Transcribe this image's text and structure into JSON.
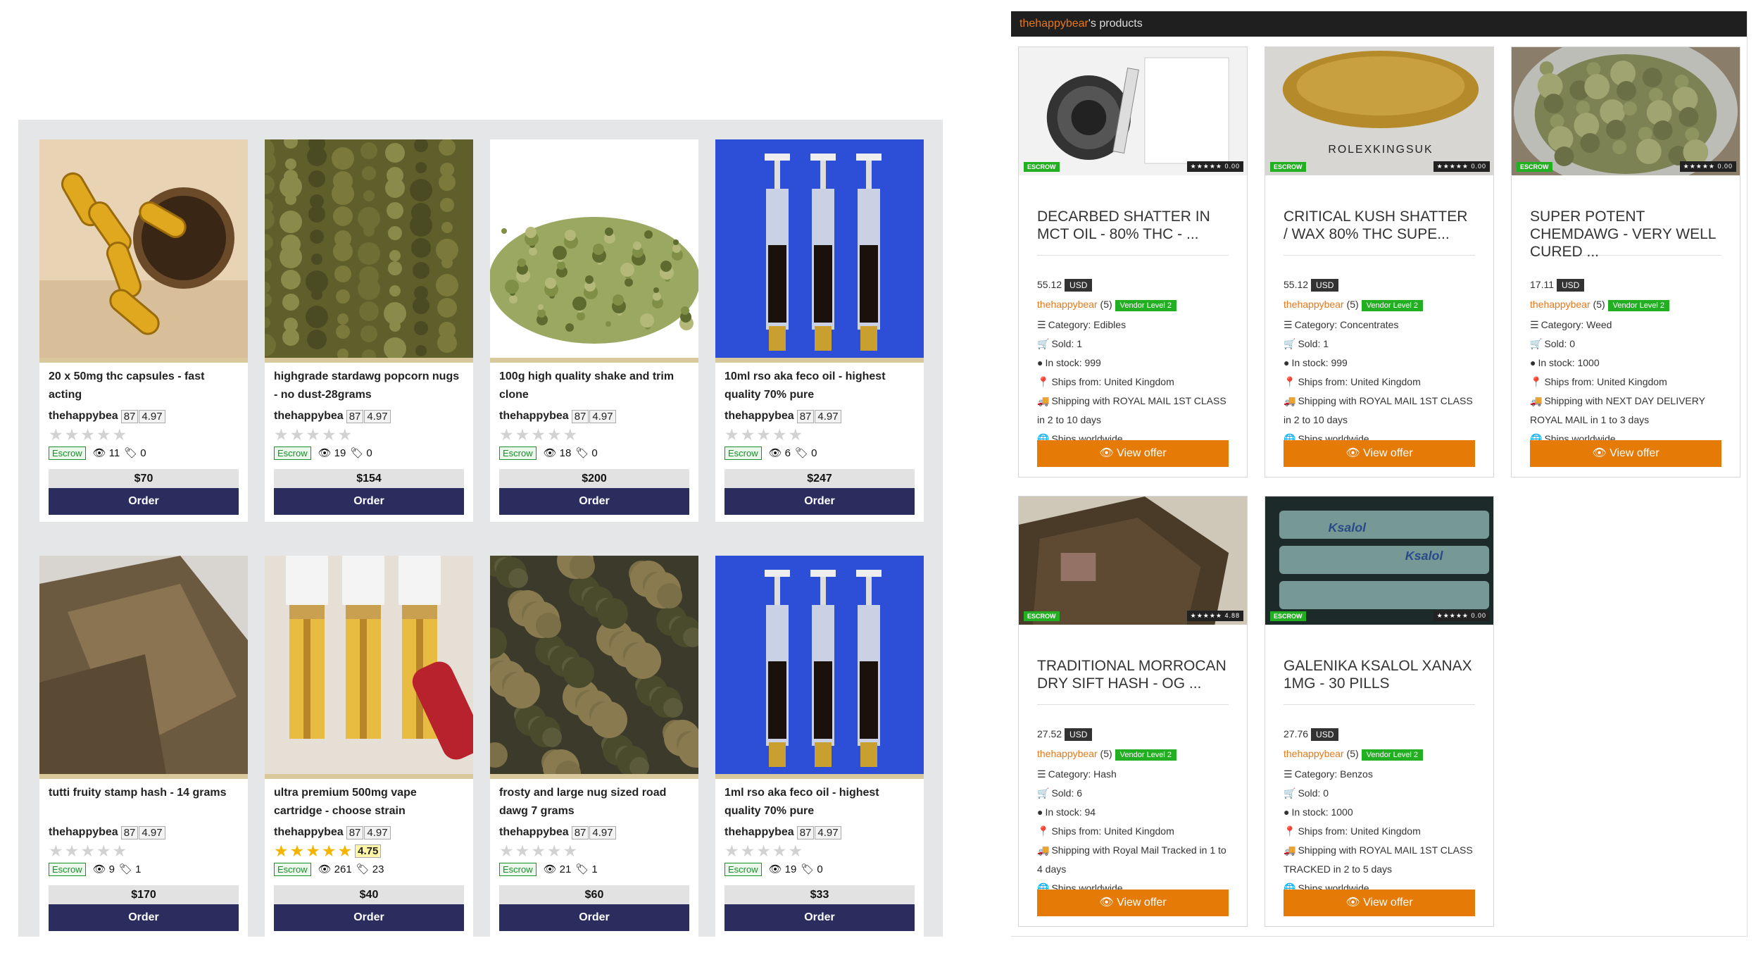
{
  "left": {
    "products": [
      {
        "title": "20 x 50mg thc capsules - fast acting",
        "vendor": "thehappybea",
        "vendor_count": "87",
        "vendor_rating": "4.97",
        "product_rating": "",
        "escrow": "Escrow",
        "views": "11",
        "sales": "0",
        "price": "$70",
        "order": "Order",
        "image": "capsules"
      },
      {
        "title": "highgrade stardawg popcorn nugs - no dust-28grams",
        "vendor": "thehappybea",
        "vendor_count": "87",
        "vendor_rating": "4.97",
        "product_rating": "",
        "escrow": "Escrow",
        "views": "19",
        "sales": "0",
        "price": "$154",
        "order": "Order",
        "image": "popcorn-nugs"
      },
      {
        "title": "100g high quality shake and trim clone",
        "vendor": "thehappybea",
        "vendor_count": "87",
        "vendor_rating": "4.97",
        "product_rating": "",
        "escrow": "Escrow",
        "views": "18",
        "sales": "0",
        "price": "$200",
        "order": "Order",
        "image": "shake"
      },
      {
        "title": "10ml rso aka feco oil - highest quality 70% pure",
        "vendor": "thehappybea",
        "vendor_count": "87",
        "vendor_rating": "4.97",
        "product_rating": "",
        "escrow": "Escrow",
        "views": "6",
        "sales": "0",
        "price": "$247",
        "order": "Order",
        "image": "syringes"
      },
      {
        "title": "tutti fruity stamp hash - 14 grams",
        "vendor": "thehappybea",
        "vendor_count": "87",
        "vendor_rating": "4.97",
        "product_rating": "",
        "escrow": "Escrow",
        "views": "9",
        "sales": "1",
        "price": "$170",
        "order": "Order",
        "image": "hash"
      },
      {
        "title": "ultra premium 500mg vape cartridge - choose strain",
        "vendor": "thehappybea",
        "vendor_count": "87",
        "vendor_rating": "4.97",
        "product_rating": "4.75",
        "escrow": "Escrow",
        "views": "261",
        "sales": "23",
        "price": "$40",
        "order": "Order",
        "image": "vape"
      },
      {
        "title": "frosty and large nug sized road dawg 7 grams",
        "vendor": "thehappybea",
        "vendor_count": "87",
        "vendor_rating": "4.97",
        "product_rating": "",
        "escrow": "Escrow",
        "views": "21",
        "sales": "1",
        "price": "$60",
        "order": "Order",
        "image": "nug"
      },
      {
        "title": "1ml rso aka feco oil - highest quality 70% pure",
        "vendor": "thehappybea",
        "vendor_count": "87",
        "vendor_rating": "4.97",
        "product_rating": "",
        "escrow": "Escrow",
        "views": "19",
        "sales": "0",
        "price": "$33",
        "order": "Order",
        "image": "syringes"
      }
    ]
  },
  "right": {
    "header_vendor": "thehappybear",
    "header_suffix": "'s products",
    "products": [
      {
        "title": "DECARBED SHATTER IN MCT OIL - 80% THC - ...",
        "price": "55.12",
        "currency": "USD",
        "vendor": "thehappybear",
        "vendor_count": "(5)",
        "level": "Vendor Level 2",
        "category": "Category: Edibles",
        "sold": "Sold: 1",
        "stock": "In stock: 999",
        "ships_from": "Ships from: United Kingdom",
        "shipping": "Shipping with ROYAL MAIL 1ST CLASS in 2 to 10 days",
        "worldwide": "Ships worldwide",
        "button": "View offer",
        "escrow": "ESCROW",
        "stars": "★★★★★ 0.00",
        "image": "jar-syringe"
      },
      {
        "title": "CRITICAL KUSH SHATTER / WAX 80% THC SUPE...",
        "price": "55.12",
        "currency": "USD",
        "vendor": "thehappybear",
        "vendor_count": "(5)",
        "level": "Vendor Level 2",
        "category": "Category: Concentrates",
        "sold": "Sold: 1",
        "stock": "In stock: 999",
        "ships_from": "Ships from: United Kingdom",
        "shipping": "Shipping with ROYAL MAIL 1ST CLASS in 2 to 10 days",
        "worldwide": "Ships worldwide",
        "button": "View offer",
        "escrow": "ESCROW",
        "stars": "★★★★★ 0.00",
        "image": "shatter",
        "image_text": "ROLEXKINGSUK"
      },
      {
        "title": "SUPER POTENT CHEMDAWG - VERY WELL CURED ...",
        "price": "17.11",
        "currency": "USD",
        "vendor": "thehappybear",
        "vendor_count": "(5)",
        "level": "Vendor Level 2",
        "category": "Category: Weed",
        "sold": "Sold: 0",
        "stock": "In stock: 1000",
        "ships_from": "Ships from: United Kingdom",
        "shipping": "Shipping with NEXT DAY DELIVERY ROYAL MAIL in 1 to 3 days",
        "worldwide": "Ships worldwide",
        "button": "View offer",
        "escrow": "ESCROW",
        "stars": "★★★★★ 0.00",
        "image": "weed-jar"
      },
      {
        "title": "TRADITIONAL MORROCAN DRY SIFT HASH - OG ...",
        "price": "27.52",
        "currency": "USD",
        "vendor": "thehappybear",
        "vendor_count": "(5)",
        "level": "Vendor Level 2",
        "category": "Category: Hash",
        "sold": "Sold: 6",
        "stock": "In stock: 94",
        "ships_from": "Ships from: United Kingdom",
        "shipping": "Shipping with Royal Mail Tracked in 1 to 4 days",
        "worldwide": "Ships worldwide",
        "button": "View offer",
        "escrow": "ESCROW",
        "stars": "★★★★★ 4.88",
        "image": "hash-block"
      },
      {
        "title": "GALENIKA KSALOL XANAX 1MG - 30 PILLS",
        "price": "27.76",
        "currency": "USD",
        "vendor": "thehappybear",
        "vendor_count": "(5)",
        "level": "Vendor Level 2",
        "category": "Category: Benzos",
        "sold": "Sold: 0",
        "stock": "In stock: 1000",
        "ships_from": "Ships from: United Kingdom",
        "shipping": "Shipping with ROYAL MAIL 1ST CLASS TRACKED in 2 to 5 days",
        "worldwide": "Ships worldwide",
        "button": "View offer",
        "escrow": "ESCROW",
        "stars": "★★★★★ 0.00",
        "image": "pills",
        "image_text": "Ksalol"
      }
    ]
  }
}
